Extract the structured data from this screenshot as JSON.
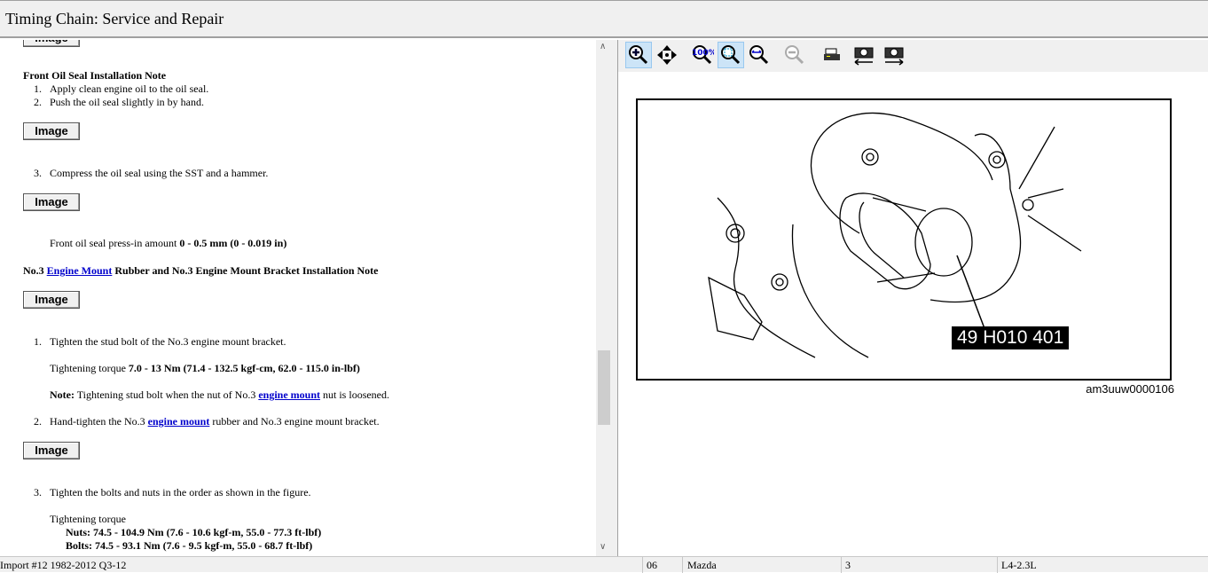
{
  "window": {
    "title": "Timing Chain:  Service and Repair"
  },
  "content": {
    "image_button_label": "Image",
    "front_oil_seal": {
      "heading": "Front Oil Seal Installation Note",
      "steps": [
        "Apply clean engine oil to the oil seal.",
        "Push the oil seal slightly in by hand.",
        "Compress the oil seal using the SST and a hammer."
      ],
      "step_numbers": [
        "1.",
        "2.",
        "3."
      ],
      "press_in_label": "Front oil seal press-in amount ",
      "press_in_value": "0 - 0.5 mm (0 - 0.019 in)"
    },
    "engine_mount": {
      "heading_prefix": "No.3 ",
      "heading_link": "Engine Mount",
      "heading_suffix": " Rubber and No.3 Engine Mount Bracket Installation Note",
      "step1": "Tighten the stud bolt of the No.3 engine mount bracket.",
      "torque_label": "Tightening torque ",
      "torque1_value": "7.0 - 13 Nm (71.4 - 132.5 kgf-cm, 62.0 - 115.0 in-lbf)",
      "note_label": "Note:",
      "note_text_pre": " Tightening stud bolt when the nut of No.3 ",
      "note_link": "engine mount",
      "note_text_post": " nut is loosened.",
      "step2_pre": "Hand-tighten the No.3 ",
      "step2_link": "engine mount",
      "step2_post": " rubber and No.3 engine mount bracket.",
      "step3": "Tighten the bolts and nuts in the order as shown in the figure.",
      "torque_heading": "Tightening torque",
      "nuts": "Nuts: 74.5 - 104.9 Nm (7.6 - 10.6 kgf-m, 55.0 - 77.3 ft-lbf)",
      "bolts": "Bolts: 74.5 - 93.1 Nm (7.6 - 9.5 kgf-m, 55.0 - 68.7 ft-lbf)",
      "step_numbers": [
        "1.",
        "2.",
        "3."
      ]
    }
  },
  "toolbar": {
    "buttons": [
      "zoom-in",
      "pan",
      "actual-size",
      "fit-to-window",
      "fit-width",
      "zoom-out",
      "print",
      "previous-image",
      "next-image"
    ]
  },
  "figure": {
    "tool_label": "49 H010 401",
    "caption": "am3uuw0000106"
  },
  "statusbar": {
    "source": "Import #12 1982-2012 Q3-12",
    "code": "06",
    "make": "Mazda",
    "model": "3",
    "engine": "L4-2.3L"
  }
}
